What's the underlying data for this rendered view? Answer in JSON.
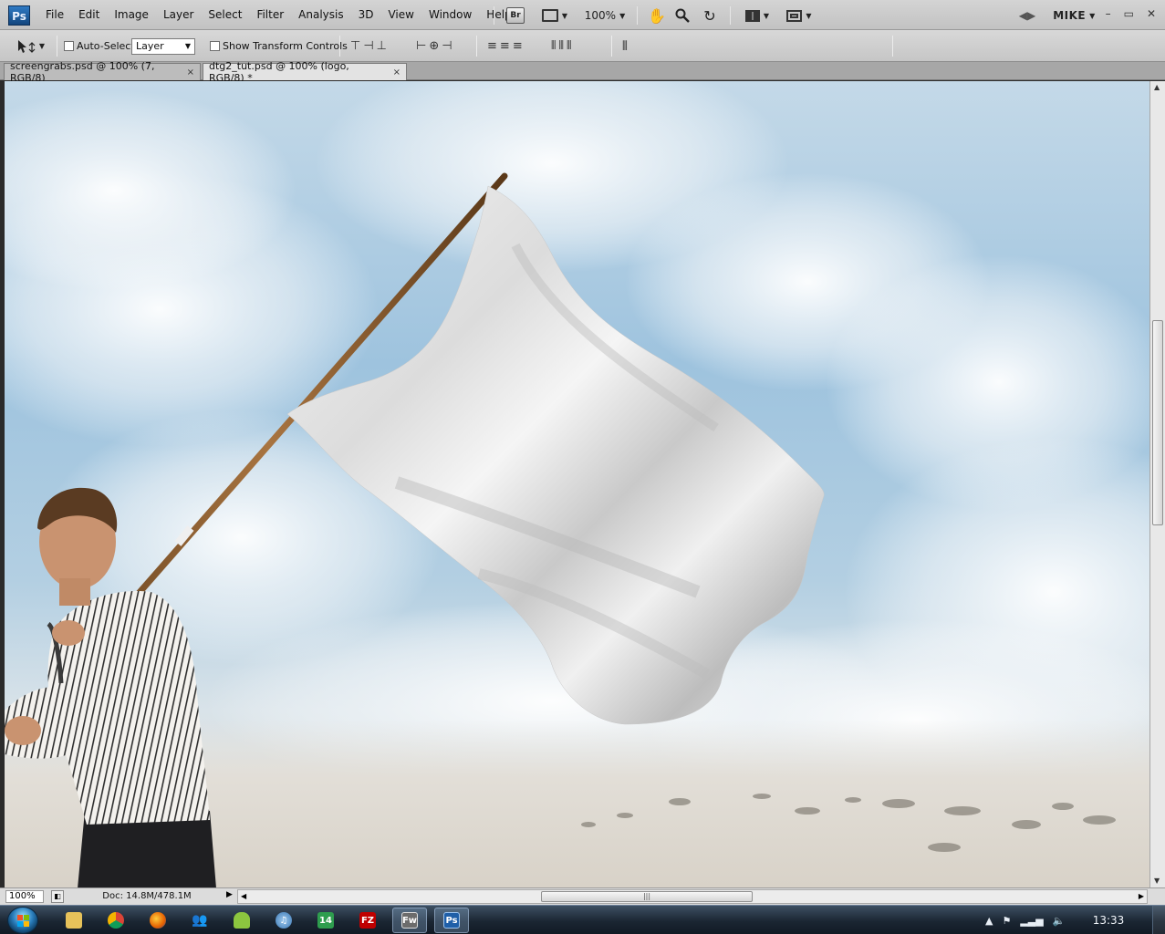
{
  "app": {
    "logo": "Ps",
    "menu": [
      "File",
      "Edit",
      "Image",
      "Layer",
      "Select",
      "Filter",
      "Analysis",
      "3D",
      "View",
      "Window",
      "Help"
    ],
    "bridge_label": "Br",
    "zoom": "100%",
    "workspace": "MIKE",
    "window_controls": [
      "–",
      "▭",
      "✕"
    ]
  },
  "options": {
    "auto_select_label": "Auto-Select:",
    "auto_select_value": "Layer",
    "transform_label": "Show Transform Controls"
  },
  "tabs": [
    {
      "label": "screengrabs.psd @ 100% (7, RGB/8)",
      "close": "×",
      "active": false
    },
    {
      "label": "dtg2_tut.psd @ 100% (logo, RGB/8) *",
      "close": "×",
      "active": true
    }
  ],
  "status": {
    "zoom": "100%",
    "doc": "Doc: 14.8M/478.1M",
    "arrow": "▶"
  },
  "taskbar": {
    "apps": [
      {
        "name": "explorer",
        "label": ""
      },
      {
        "name": "chrome",
        "label": ""
      },
      {
        "name": "firefox",
        "label": ""
      },
      {
        "name": "messenger",
        "label": ""
      },
      {
        "name": "android",
        "label": ""
      },
      {
        "name": "itunes",
        "label": ""
      },
      {
        "name": "manager",
        "label": "14"
      },
      {
        "name": "filezilla",
        "label": "FZ"
      },
      {
        "name": "fireworks",
        "label": "Fw"
      },
      {
        "name": "photoshop",
        "label": "Ps"
      }
    ],
    "clock": "13:33"
  },
  "colors": {
    "sky_top": "#b9d2e3",
    "sky_blue": "#8fb8d8",
    "ground": "#ddd8d0",
    "flag": "#e9e9e9",
    "pole": "#8a5a2b",
    "shirt_stripe": "#2f2f2f",
    "taskbar": "#1b2633"
  }
}
